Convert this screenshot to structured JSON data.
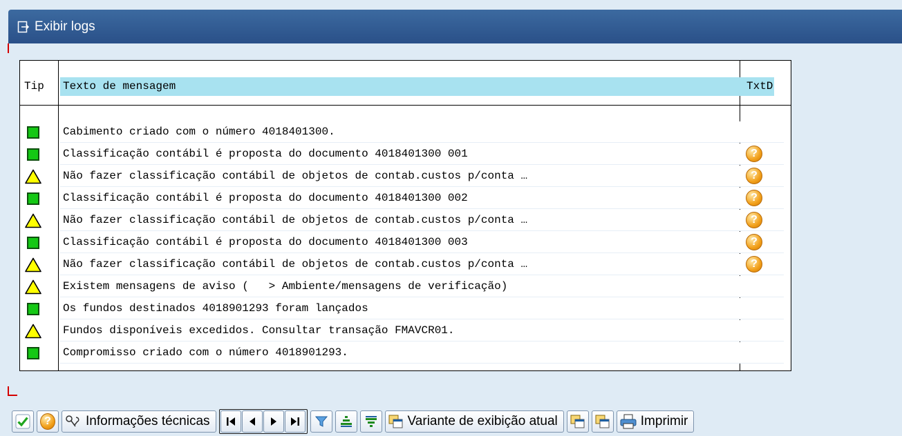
{
  "window": {
    "title": "Exibir logs"
  },
  "table": {
    "headers": {
      "tip": "Tip",
      "text": "Texto de mensagem",
      "txtd": "TxtD"
    },
    "rows": [
      {
        "tip": "success",
        "text": "Cabimento criado com o número 4018401300.",
        "help": false
      },
      {
        "tip": "success",
        "text": "Classificação contábil é proposta do documento 4018401300 001",
        "help": true
      },
      {
        "tip": "warning",
        "text": "Não fazer classificação contábil de objetos de contab.custos p/conta …",
        "help": true
      },
      {
        "tip": "success",
        "text": "Classificação contábil é proposta do documento 4018401300 002",
        "help": true
      },
      {
        "tip": "warning",
        "text": "Não fazer classificação contábil de objetos de contab.custos p/conta …",
        "help": true
      },
      {
        "tip": "success",
        "text": "Classificação contábil é proposta do documento 4018401300 003",
        "help": true
      },
      {
        "tip": "warning",
        "text": "Não fazer classificação contábil de objetos de contab.custos p/conta …",
        "help": true
      },
      {
        "tip": "warning",
        "text": "Existem mensagens de aviso (   > Ambiente/mensagens de verificação)",
        "help": false
      },
      {
        "tip": "success",
        "text": "Os fundos destinados 4018901293 foram lançados",
        "help": false
      },
      {
        "tip": "warning",
        "text": "Fundos disponíveis excedidos. Consultar transação FMAVCR01.",
        "help": false
      },
      {
        "tip": "success",
        "text": "Compromisso criado com o número 4018901293.",
        "help": false
      }
    ]
  },
  "toolbar": {
    "tech_info_label": "Informações técnicas",
    "layout_label": "Variante de exibição atual",
    "print_label": "Imprimir"
  },
  "icons": {
    "title": "export-icon",
    "status_success": "green-square-icon",
    "status_warning": "warning-triangle-icon",
    "help": "question-icon"
  },
  "colors": {
    "header_bg": "#a8e2f0",
    "success": "#14c814",
    "warning": "#ffff00",
    "title_bar": "#2a5088"
  }
}
